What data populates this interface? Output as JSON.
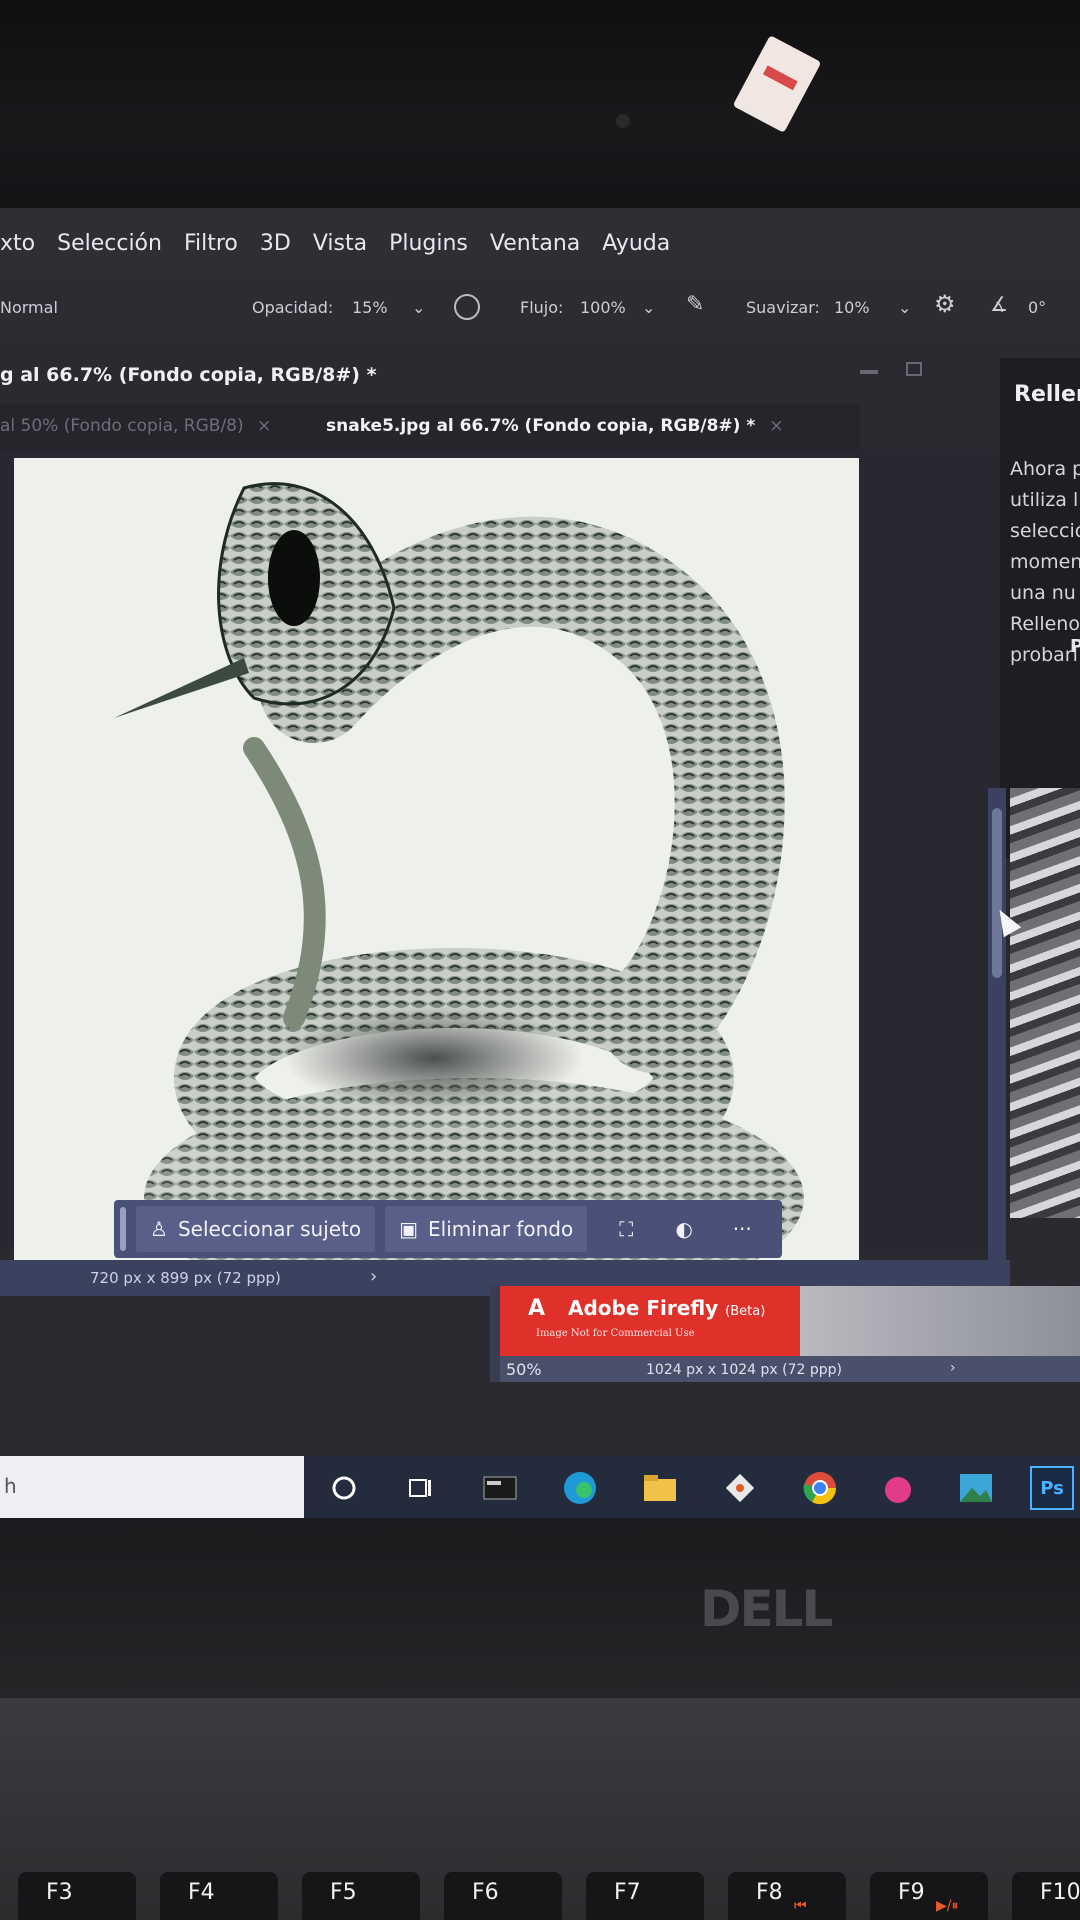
{
  "menubar": {
    "items": [
      "xto",
      "Selección",
      "Filtro",
      "3D",
      "Vista",
      "Plugins",
      "Ventana",
      "Ayuda"
    ]
  },
  "options_bar": {
    "mode": "Normal",
    "opacity_label": "Opacidad:",
    "opacity_value": "15%",
    "flow_label": "Flujo:",
    "flow_value": "100%",
    "smoothing_label": "Suavizar:",
    "smoothing_value": "10%",
    "angle_value": "0°"
  },
  "document": {
    "window_title": "g al 66.7% (Fondo copia, RGB/8#) *",
    "tabs": [
      {
        "label": "al 50% (Fondo copia, RGB/8)",
        "close": "×"
      },
      {
        "label": "snake5.jpg al 66.7% (Fondo copia, RGB/8#) *",
        "close": "×"
      }
    ],
    "status_dims": "720 px x 899 px (72 ppp)",
    "status_chevron": "›"
  },
  "context_bar": {
    "select_subject": "Seleccionar sujeto",
    "remove_background": "Eliminar fondo",
    "more": "···"
  },
  "side_panel": {
    "title": "Rellen",
    "lines": [
      "Ahora p",
      "utiliza l",
      "selecció",
      "momen",
      "una nu",
      "Relleno",
      "probarl"
    ],
    "footer_letter": "P"
  },
  "firefly_window": {
    "app_name": "Adobe Firefly",
    "badge": "(Beta)",
    "subtitle": "Image Not for Commercial Use",
    "zoom": "50%",
    "dims": "1024 px x 1024 px (72 ppp)",
    "chevron": "›"
  },
  "taskbar": {
    "search_text": "h",
    "pinned": [
      "cortana-icon",
      "task-view-icon",
      "media-icon",
      "edge-icon",
      "file-explorer-icon",
      "git-icon",
      "chrome-icon",
      "app-icon",
      "photos-icon",
      "photoshop-icon"
    ],
    "ps_label": "Ps"
  },
  "device": {
    "brand": "DELL"
  },
  "keyboard": {
    "keys": [
      {
        "label": "F3",
        "sub": ""
      },
      {
        "label": "F4",
        "sub": ""
      },
      {
        "label": "F5",
        "sub": ""
      },
      {
        "label": "F6",
        "sub": ""
      },
      {
        "label": "F7",
        "sub": ""
      },
      {
        "label": "F8",
        "sub": "⏮"
      },
      {
        "label": "F9",
        "sub": "▶/⏸"
      },
      {
        "label": "F10",
        "sub": ""
      }
    ]
  },
  "colors": {
    "photoshop_bg": "#2b2a31",
    "context_bar": "#4a5178",
    "firefly_red": "#e0302a"
  }
}
